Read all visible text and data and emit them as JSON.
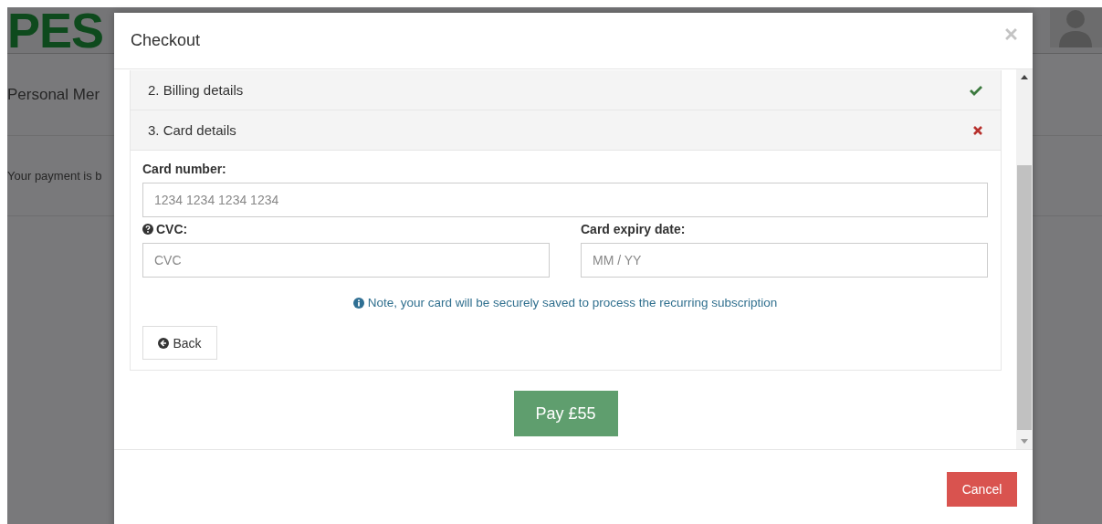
{
  "page": {
    "logo": "PES",
    "heading": "Personal Mer",
    "message": "Your payment is b"
  },
  "modal": {
    "title": "Checkout"
  },
  "steps": [
    {
      "label": "2. Billing details",
      "complete": true
    },
    {
      "label": "3. Card details",
      "complete": false
    }
  ],
  "form": {
    "card_number": {
      "label": "Card number:",
      "placeholder": "1234 1234 1234 1234"
    },
    "cvc": {
      "label": "CVC:",
      "placeholder": "CVC"
    },
    "expiry": {
      "label": "Card expiry date:",
      "placeholder": "MM / YY"
    },
    "note": "Note, your card will be securely saved to process the recurring subscription",
    "back_button": "Back"
  },
  "pay_button": "Pay £55",
  "cancel_button": "Cancel"
}
